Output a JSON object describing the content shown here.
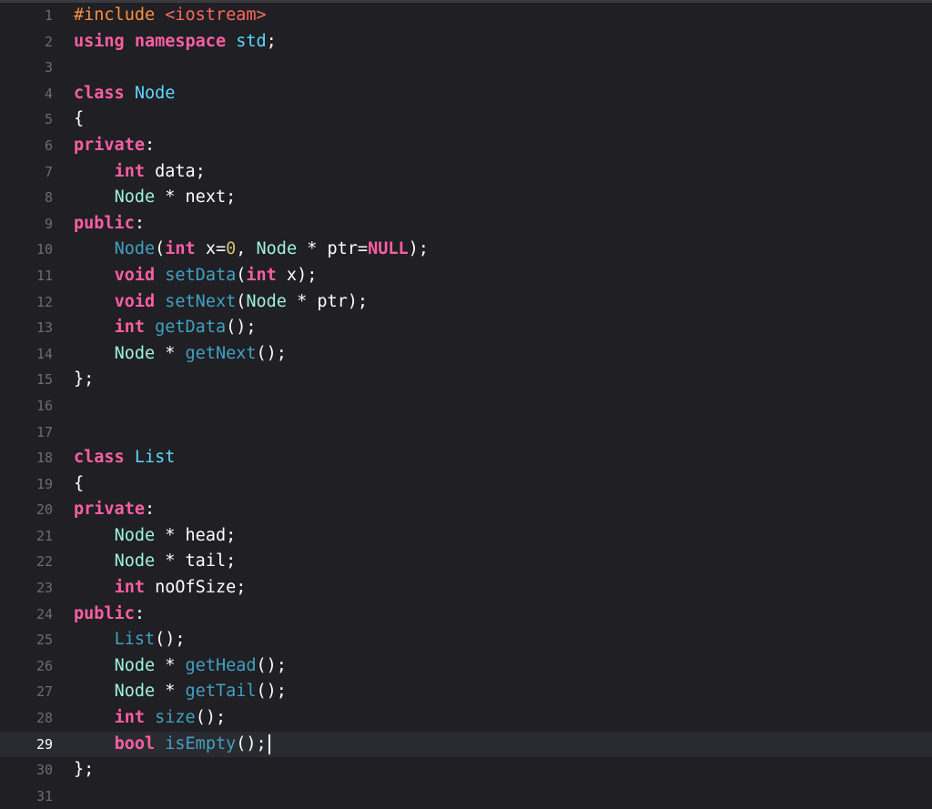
{
  "editor": {
    "current_line": 29,
    "colors": {
      "background": "#1f1f24",
      "current_line_background": "#2a2b31",
      "keyword": "#fc5fa3",
      "preprocessor": "#fd8f3f",
      "string": "#fc6a5d",
      "type": "#9ef1dd",
      "function_call": "#41a1c0",
      "number": "#d0bf69",
      "declaration": "#5dd8ff",
      "plain": "#ffffff",
      "line_number": "#6c6c72"
    },
    "lines": [
      {
        "n": "1",
        "tokens": [
          [
            "pp",
            "#include "
          ],
          [
            "str",
            "<iostream>"
          ]
        ]
      },
      {
        "n": "2",
        "tokens": [
          [
            "kw",
            "using"
          ],
          [
            "plain",
            " "
          ],
          [
            "kw",
            "namespace"
          ],
          [
            "plain",
            " "
          ],
          [
            "decl",
            "std"
          ],
          [
            "plain",
            ";"
          ]
        ]
      },
      {
        "n": "3",
        "tokens": []
      },
      {
        "n": "4",
        "tokens": [
          [
            "kw",
            "class"
          ],
          [
            "plain",
            " "
          ],
          [
            "decl",
            "Node"
          ]
        ]
      },
      {
        "n": "5",
        "tokens": [
          [
            "plain",
            "{"
          ]
        ]
      },
      {
        "n": "6",
        "tokens": [
          [
            "kw",
            "private"
          ],
          [
            "plain",
            ":"
          ]
        ]
      },
      {
        "n": "7",
        "tokens": [
          [
            "plain",
            "    "
          ],
          [
            "kw",
            "int"
          ],
          [
            "plain",
            " data;"
          ]
        ]
      },
      {
        "n": "8",
        "tokens": [
          [
            "plain",
            "    "
          ],
          [
            "type",
            "Node"
          ],
          [
            "plain",
            " * next;"
          ]
        ]
      },
      {
        "n": "9",
        "tokens": [
          [
            "kw",
            "public"
          ],
          [
            "plain",
            ":"
          ]
        ]
      },
      {
        "n": "10",
        "tokens": [
          [
            "plain",
            "    "
          ],
          [
            "call",
            "Node"
          ],
          [
            "plain",
            "("
          ],
          [
            "kw",
            "int"
          ],
          [
            "plain",
            " x="
          ],
          [
            "num",
            "0"
          ],
          [
            "plain",
            ", "
          ],
          [
            "type",
            "Node"
          ],
          [
            "plain",
            " * ptr="
          ],
          [
            "kw",
            "NULL"
          ],
          [
            "plain",
            ");"
          ]
        ]
      },
      {
        "n": "11",
        "tokens": [
          [
            "plain",
            "    "
          ],
          [
            "kw",
            "void"
          ],
          [
            "plain",
            " "
          ],
          [
            "call",
            "setData"
          ],
          [
            "plain",
            "("
          ],
          [
            "kw",
            "int"
          ],
          [
            "plain",
            " x);"
          ]
        ]
      },
      {
        "n": "12",
        "tokens": [
          [
            "plain",
            "    "
          ],
          [
            "kw",
            "void"
          ],
          [
            "plain",
            " "
          ],
          [
            "call",
            "setNext"
          ],
          [
            "plain",
            "("
          ],
          [
            "type",
            "Node"
          ],
          [
            "plain",
            " * ptr);"
          ]
        ]
      },
      {
        "n": "13",
        "tokens": [
          [
            "plain",
            "    "
          ],
          [
            "kw",
            "int"
          ],
          [
            "plain",
            " "
          ],
          [
            "call",
            "getData"
          ],
          [
            "plain",
            "();"
          ]
        ]
      },
      {
        "n": "14",
        "tokens": [
          [
            "plain",
            "    "
          ],
          [
            "type",
            "Node"
          ],
          [
            "plain",
            " * "
          ],
          [
            "call",
            "getNext"
          ],
          [
            "plain",
            "();"
          ]
        ]
      },
      {
        "n": "15",
        "tokens": [
          [
            "plain",
            "};"
          ]
        ]
      },
      {
        "n": "16",
        "tokens": []
      },
      {
        "n": "17",
        "tokens": []
      },
      {
        "n": "18",
        "tokens": [
          [
            "kw",
            "class"
          ],
          [
            "plain",
            " "
          ],
          [
            "decl",
            "List"
          ]
        ]
      },
      {
        "n": "19",
        "tokens": [
          [
            "plain",
            "{"
          ]
        ]
      },
      {
        "n": "20",
        "tokens": [
          [
            "kw",
            "private"
          ],
          [
            "plain",
            ":"
          ]
        ]
      },
      {
        "n": "21",
        "tokens": [
          [
            "plain",
            "    "
          ],
          [
            "type",
            "Node"
          ],
          [
            "plain",
            " * head;"
          ]
        ]
      },
      {
        "n": "22",
        "tokens": [
          [
            "plain",
            "    "
          ],
          [
            "type",
            "Node"
          ],
          [
            "plain",
            " * tail;"
          ]
        ]
      },
      {
        "n": "23",
        "tokens": [
          [
            "plain",
            "    "
          ],
          [
            "kw",
            "int"
          ],
          [
            "plain",
            " noOfSize;"
          ]
        ]
      },
      {
        "n": "24",
        "tokens": [
          [
            "kw",
            "public"
          ],
          [
            "plain",
            ":"
          ]
        ]
      },
      {
        "n": "25",
        "tokens": [
          [
            "plain",
            "    "
          ],
          [
            "call",
            "List"
          ],
          [
            "plain",
            "();"
          ]
        ]
      },
      {
        "n": "26",
        "tokens": [
          [
            "plain",
            "    "
          ],
          [
            "type",
            "Node"
          ],
          [
            "plain",
            " * "
          ],
          [
            "call",
            "getHead"
          ],
          [
            "plain",
            "();"
          ]
        ]
      },
      {
        "n": "27",
        "tokens": [
          [
            "plain",
            "    "
          ],
          [
            "type",
            "Node"
          ],
          [
            "plain",
            " * "
          ],
          [
            "call",
            "getTail"
          ],
          [
            "plain",
            "();"
          ]
        ]
      },
      {
        "n": "28",
        "tokens": [
          [
            "plain",
            "    "
          ],
          [
            "kw",
            "int"
          ],
          [
            "plain",
            " "
          ],
          [
            "call",
            "size"
          ],
          [
            "plain",
            "();"
          ]
        ]
      },
      {
        "n": "29",
        "tokens": [
          [
            "plain",
            "    "
          ],
          [
            "kw",
            "bool"
          ],
          [
            "plain",
            " "
          ],
          [
            "call",
            "isEmpty"
          ],
          [
            "plain",
            "();"
          ]
        ]
      },
      {
        "n": "30",
        "tokens": [
          [
            "plain",
            "};"
          ]
        ]
      },
      {
        "n": "31",
        "tokens": []
      }
    ]
  }
}
